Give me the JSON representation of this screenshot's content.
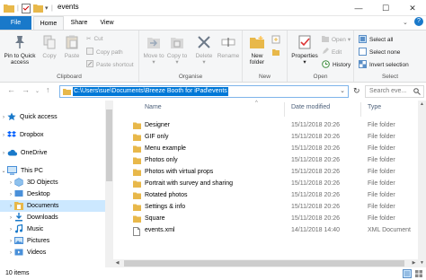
{
  "window": {
    "title": "events"
  },
  "tabs": [
    {
      "label": "File"
    },
    {
      "label": "Home"
    },
    {
      "label": "Share"
    },
    {
      "label": "View"
    }
  ],
  "ribbon": {
    "clipboard": {
      "label": "Clipboard",
      "pin": "Pin to Quick access",
      "copy": "Copy",
      "paste": "Paste",
      "cut": "Cut",
      "copy_path": "Copy path",
      "paste_shortcut": "Paste shortcut"
    },
    "organise": {
      "label": "Organise",
      "move_to": "Move to",
      "copy_to": "Copy to",
      "delete": "Delete",
      "rename": "Rename"
    },
    "new": {
      "label": "New",
      "new_folder": "New folder"
    },
    "open": {
      "label": "Open",
      "properties": "Properties",
      "open": "Open",
      "edit": "Edit",
      "history": "History"
    },
    "select": {
      "label": "Select",
      "select_all": "Select all",
      "select_none": "Select none",
      "invert": "Invert selection"
    }
  },
  "address": {
    "path": "C:\\Users\\sue\\Documents\\Breeze Booth for iPad\\events"
  },
  "search": {
    "placeholder": "Search eve..."
  },
  "nav": {
    "items": [
      {
        "label": "Quick access"
      },
      {
        "label": "Dropbox"
      },
      {
        "label": "OneDrive"
      },
      {
        "label": "This PC"
      },
      {
        "label": "3D Objects"
      },
      {
        "label": "Desktop"
      },
      {
        "label": "Documents"
      },
      {
        "label": "Downloads"
      },
      {
        "label": "Music"
      },
      {
        "label": "Pictures"
      },
      {
        "label": "Videos"
      }
    ]
  },
  "columns": {
    "name": "Name",
    "date": "Date modified",
    "type": "Type"
  },
  "files": [
    {
      "name": "Designer",
      "date": "15/11/2018 20:26",
      "type": "File folder"
    },
    {
      "name": "GIF only",
      "date": "15/11/2018 20:26",
      "type": "File folder"
    },
    {
      "name": "Menu example",
      "date": "15/11/2018 20:26",
      "type": "File folder"
    },
    {
      "name": "Photos only",
      "date": "15/11/2018 20:26",
      "type": "File folder"
    },
    {
      "name": "Photos with virtual props",
      "date": "15/11/2018 20:26",
      "type": "File folder"
    },
    {
      "name": "Portrait with survey and sharing",
      "date": "15/11/2018 20:26",
      "type": "File folder"
    },
    {
      "name": "Rotated photos",
      "date": "15/11/2018 20:26",
      "type": "File folder"
    },
    {
      "name": "Settings & info",
      "date": "15/11/2018 20:26",
      "type": "File folder"
    },
    {
      "name": "Square",
      "date": "15/11/2018 20:26",
      "type": "File folder"
    },
    {
      "name": "events.xml",
      "date": "14/11/2018 14:40",
      "type": "XML Document"
    }
  ],
  "status": {
    "count": "10 items"
  },
  "colors": {
    "accent": "#1979ca",
    "selection": "#0078d7",
    "folder": "#e8b84a"
  }
}
